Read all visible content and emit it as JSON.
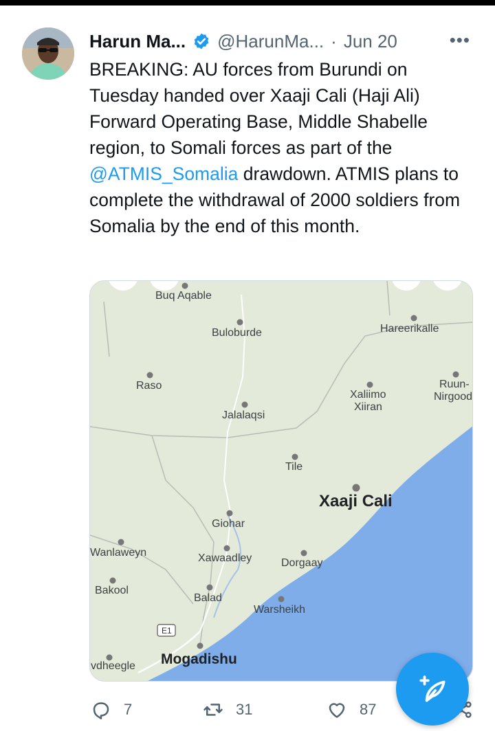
{
  "tweet": {
    "author": {
      "display_name": "Harun Ma...",
      "handle": "@HarunMa...",
      "verified": true
    },
    "separator": "·",
    "date": "Jun 20",
    "more_label": "•••",
    "text_before_mention": "BREAKING: AU forces from Burundi on Tuesday handed over Xaaji Cali (Haji Ali) Forward Operating Base, Middle Shabelle region, to Somali forces as part of the ",
    "mention": "@ATMIS_Somalia",
    "text_after_mention": " drawdown. ATMIS plans to complete the withdrawal of 2000 soldiers from Somalia by the end of this month.",
    "map": {
      "places": {
        "buq_aqable": "Buq Aqable",
        "buloburde": "Buloburde",
        "hareerikalle": "Hareerikalle",
        "raso": "Raso",
        "ruun_line1": "Ruun-",
        "ruun_line2": "Nirgood",
        "xaliimo_line1": "Xaliimo",
        "xaliimo_line2": "Xiiran",
        "jalalaqsi": "Jalalaqsi",
        "tile": "Tile",
        "xaaji_cali": "Xaaji Cali",
        "giohar": "Giohar",
        "wanlaweyn": "Wanlaweyn",
        "xawaadley": "Xawaadley",
        "dorgaay": "Dorgaay",
        "bakool": "Bakool",
        "balad": "Balad",
        "warsheikh": "Warsheikh",
        "road_e1": "E1",
        "vdheegle": "vdheegle",
        "mogadishu": "Mogadishu"
      },
      "colors": {
        "land": "#e3ead9",
        "sea": "#7fadea"
      }
    },
    "actions": {
      "reply_count": "7",
      "retweet_count": "31",
      "like_count": "87"
    }
  },
  "colors": {
    "accent": "#1d9bf0",
    "text_primary": "#0f1419",
    "text_secondary": "#536471"
  }
}
